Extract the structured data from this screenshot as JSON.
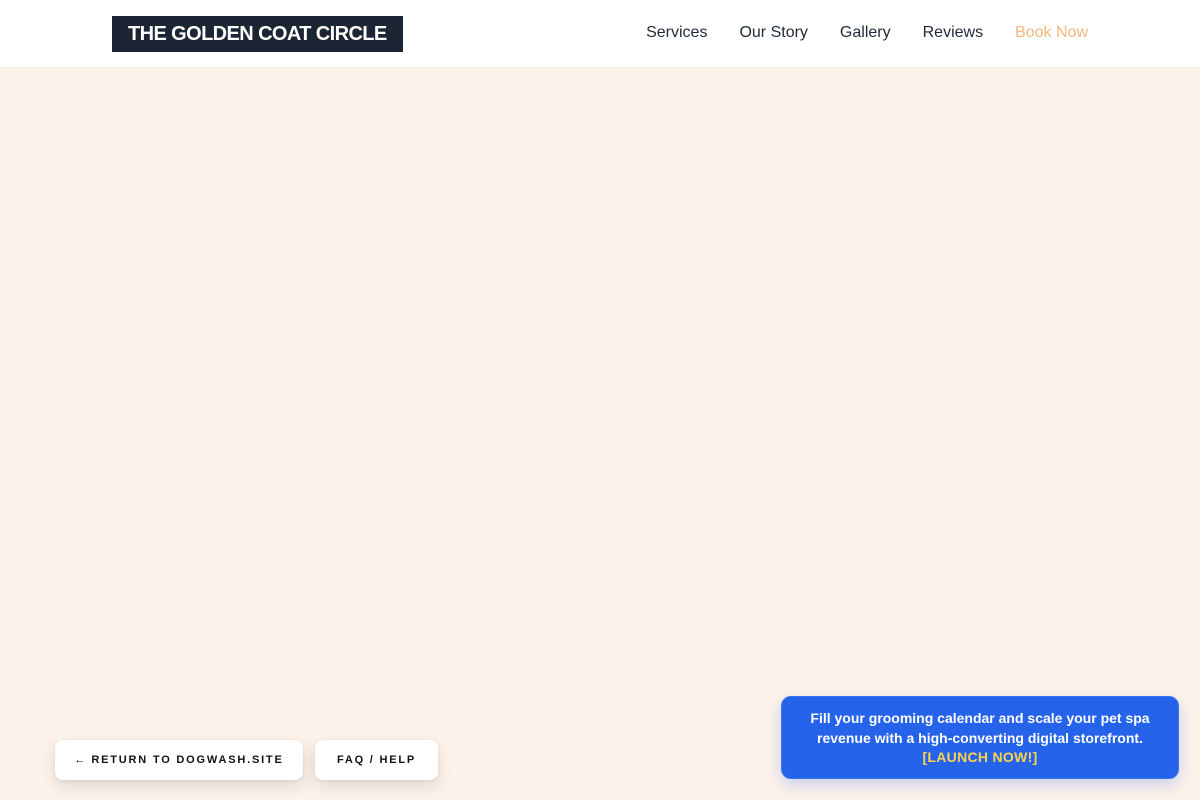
{
  "header": {
    "logo_text": "THE GOLDEN COAT CIRCLE",
    "nav": [
      {
        "label": "Services"
      },
      {
        "label": "Our Story"
      },
      {
        "label": "Gallery"
      },
      {
        "label": "Reviews"
      },
      {
        "label": "Book Now"
      }
    ]
  },
  "floating_buttons": {
    "return_label": "RETURN TO DOGWASH.SITE",
    "return_icon": "←",
    "faq_label": "FAQ / HELP"
  },
  "promo": {
    "text": "Fill your grooming calendar and scale your pet spa revenue with a high-converting digital storefront.",
    "cta": "[LAUNCH NOW!]"
  },
  "colors": {
    "background": "#fef3ea",
    "logo_bg": "#1c2533",
    "nav_text": "#1f2937",
    "book_now": "#f4b782",
    "promo_bg": "#2563eb",
    "promo_cta": "#fcd34d"
  }
}
